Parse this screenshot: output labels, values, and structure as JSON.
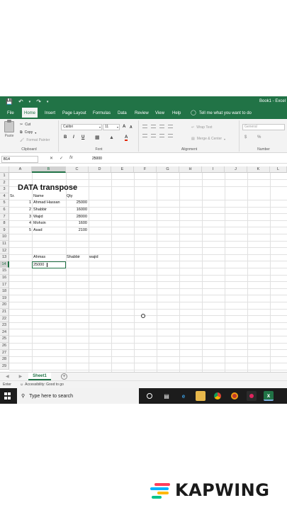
{
  "window": {
    "title": "Book1 - Excel"
  },
  "qat": {
    "save_icon": "save-icon",
    "undo_icon": "undo-icon",
    "redo_icon": "redo-icon"
  },
  "tabs": [
    "File",
    "Home",
    "Insert",
    "Page Layout",
    "Formulas",
    "Data",
    "Review",
    "View",
    "Help"
  ],
  "tell_me": "Tell me what you want to do",
  "ribbon": {
    "clipboard": {
      "paste": "Paste",
      "cut": "Cut",
      "copy": "Copy",
      "format_painter": "Format Painter",
      "label": "Clipboard"
    },
    "font": {
      "name": "Calibri",
      "size": "11",
      "bold": "B",
      "italic": "I",
      "underline": "U",
      "label": "Font",
      "inc": "A",
      "dec": "A"
    },
    "alignment": {
      "wrap_text": "Wrap Text",
      "merge_center": "Merge & Center",
      "label": "Alignment"
    },
    "number": {
      "format": "General",
      "currency": "$",
      "percent": "%",
      "label": "Number"
    }
  },
  "formula_bar": {
    "name_box": "B14",
    "value": "25000",
    "fx": "fx"
  },
  "columns": [
    "A",
    "B",
    "C",
    "D",
    "E",
    "F",
    "G",
    "H",
    "I",
    "J",
    "K",
    "L"
  ],
  "rows": [
    "1",
    "2",
    "3",
    "4",
    "5",
    "6",
    "7",
    "8",
    "9",
    "10",
    "11",
    "12",
    "13",
    "14",
    "15",
    "16",
    "17",
    "18",
    "19",
    "20",
    "21",
    "22",
    "23",
    "24",
    "25",
    "26",
    "27",
    "28",
    "29"
  ],
  "sheet": {
    "title": "DATA transpose",
    "headers": {
      "sr": "Sr.",
      "name": "Name",
      "qty": "Qty"
    },
    "records": [
      {
        "sr": "1",
        "name": "Ahmad Hassan",
        "qty": "25000"
      },
      {
        "sr": "2",
        "name": "Shabbir",
        "qty": "16000"
      },
      {
        "sr": "3",
        "name": "Wajid",
        "qty": "28000"
      },
      {
        "sr": "4",
        "name": "Mohsin",
        "qty": "1600"
      },
      {
        "sr": "5",
        "name": "Asad",
        "qty": "2100"
      }
    ],
    "transposed_names": [
      "Ahmas",
      "Shabbir",
      "wajid"
    ],
    "editing_value": "25000"
  },
  "sheet_tabs": [
    "Sheet1"
  ],
  "status": {
    "mode": "Enter",
    "accessibility": "Accessibility: Good to go"
  },
  "taskbar": {
    "search_placeholder": "Type here to search"
  },
  "watermark": "KAPWING",
  "colors": {
    "excel_green": "#217346",
    "taskbar": "#1c1c1c"
  }
}
